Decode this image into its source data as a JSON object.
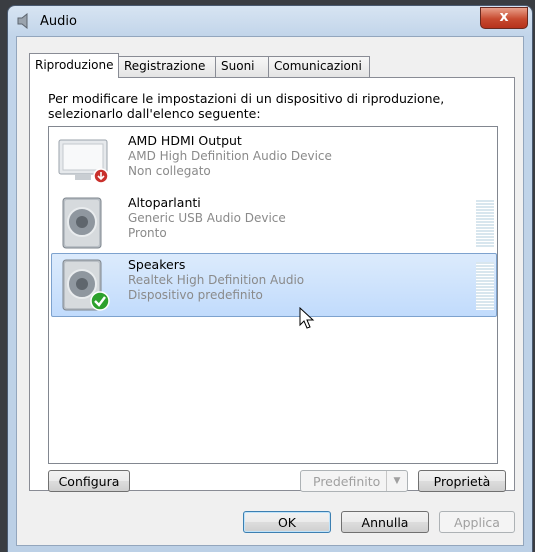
{
  "window": {
    "title": "Audio",
    "close_glyph": "x"
  },
  "tabs": [
    {
      "label": "Riproduzione",
      "active": true
    },
    {
      "label": "Registrazione",
      "active": false
    },
    {
      "label": "Suoni",
      "active": false
    },
    {
      "label": "Comunicazioni",
      "active": false
    }
  ],
  "instructions": "Per modificare le impostazioni di un dispositivo di riproduzione, selezionarlo dall'elenco seguente:",
  "devices": [
    {
      "name": "AMD HDMI Output",
      "description": "AMD High Definition Audio Device",
      "status": "Non collegato",
      "icon": "monitor-icon",
      "badge": "disconnected-arrow-icon",
      "selected": false
    },
    {
      "name": "Altoparlanti",
      "description": "Generic USB Audio Device",
      "status": "Pronto",
      "icon": "speaker-icon",
      "selected": false,
      "level": 0
    },
    {
      "name": "Speakers",
      "description": "Realtek High Definition Audio",
      "status": "Dispositivo predefinito",
      "icon": "speaker-icon",
      "badge": "default-check-icon",
      "selected": true,
      "level": 0
    }
  ],
  "buttons": {
    "configure": "Configura",
    "set_default": "Predefinito",
    "properties": "Proprietà",
    "ok": "OK",
    "cancel": "Annulla",
    "apply": "Applica"
  },
  "colors": {
    "selection": "#c1dbfc",
    "close": "#c74a30",
    "check": "#2da12d"
  }
}
